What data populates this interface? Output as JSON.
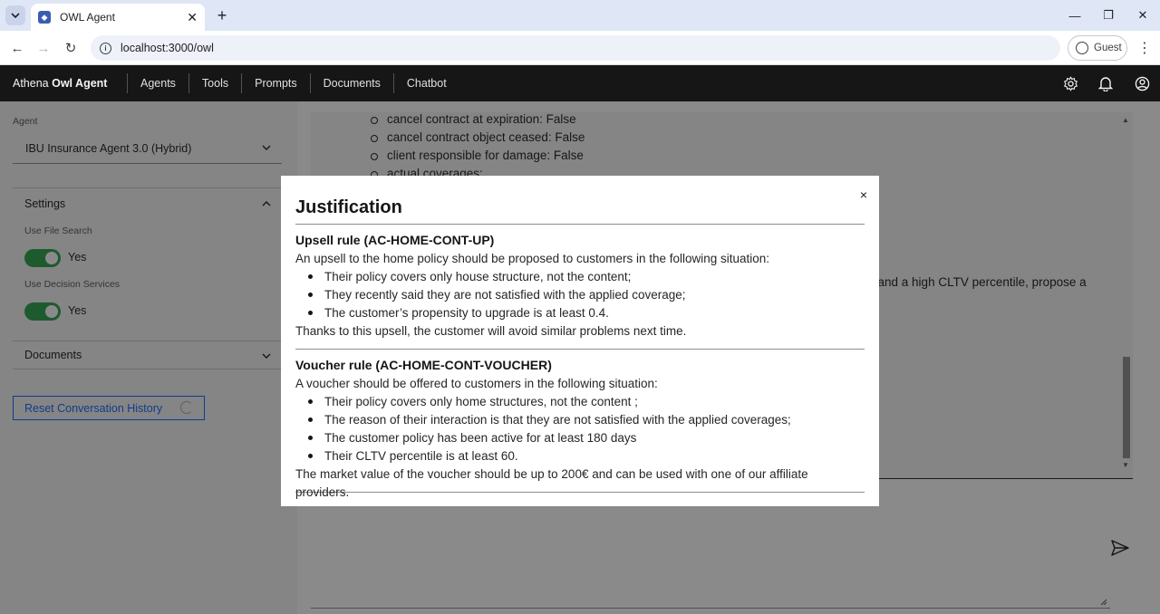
{
  "browser": {
    "tab_title": "OWL Agent",
    "url": "localhost:3000/owl",
    "profile_label": "Guest"
  },
  "header": {
    "brand_prefix": "Athena",
    "brand_name": "Owl Agent",
    "nav": [
      "Agents",
      "Tools",
      "Prompts",
      "Documents",
      "Chatbot"
    ]
  },
  "sidebar": {
    "agent_label": "Agent",
    "agent_value": "IBU Insurance Agent 3.0 (Hybrid)",
    "settings_title": "Settings",
    "file_search_label": "Use File Search",
    "file_search_value": "Yes",
    "decision_label": "Use Decision Services",
    "decision_value": "Yes",
    "documents_title": "Documents",
    "reset_label": "Reset Conversation History"
  },
  "conversation": {
    "items": [
      "cancel contract at expiration: False",
      "cancel contract object ceased: False",
      "client responsible for damage: False",
      "actual coverages:"
    ],
    "partial_line": "ges and a high CLTV percentile, propose a"
  },
  "modal": {
    "title": "Justification",
    "close_label": "×",
    "rules": [
      {
        "title": "Upsell rule (AC-HOME-CONT-UP)",
        "intro": "An upsell to the home policy should be proposed to customers in the following situation:",
        "items": [
          "Their policy covers only house structure, not the content;",
          "They recently said they are not satisfied with the applied coverage;",
          "The customer’s propensity to upgrade is at least 0.4."
        ],
        "outro": "Thanks to this upsell, the customer will avoid similar problems next time."
      },
      {
        "title": "Voucher rule (AC-HOME-CONT-VOUCHER)",
        "intro": "A voucher should be offered to customers in the following situation:",
        "items": [
          "Their policy covers only home structures, not the content ;",
          "The reason of their interaction is that they are not satisfied with the applied coverages;",
          "The customer policy has been active for at least 180 days",
          "Their CLTV percentile is at least 60."
        ],
        "outro": "The market value of the voucher should be up to 200€ and can be used with one of our affiliate providers."
      }
    ]
  },
  "colors": {
    "header_bg": "#161616",
    "toggle_on": "#24a148",
    "link_blue": "#0f62fe"
  }
}
